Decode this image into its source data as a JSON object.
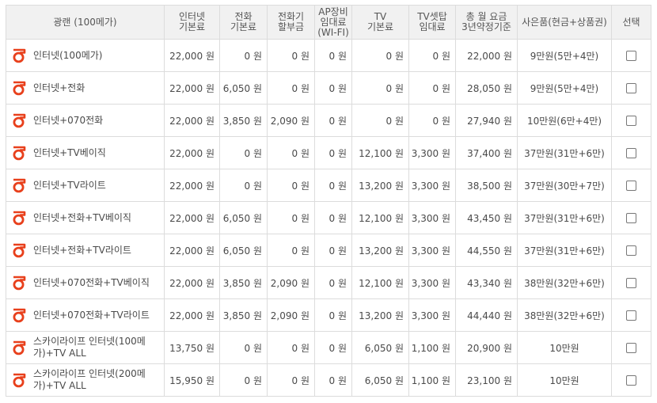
{
  "colors": {
    "brand": "#e8401c",
    "header_bg": "#f1f1f1",
    "border": "#dcdcdc"
  },
  "header": {
    "plan": "광랜 (100메가)",
    "internet": [
      "인터넷",
      "기본료"
    ],
    "phone": [
      "전화",
      "기본료"
    ],
    "phone_device": [
      "전화기",
      "할부금"
    ],
    "ap": [
      "AP장비",
      "임대료",
      "(WI-FI)"
    ],
    "tv": [
      "TV",
      "기본료"
    ],
    "settop": [
      "TV셋탑",
      "임대료"
    ],
    "total": [
      "총 월 요금",
      "3년약정기준"
    ],
    "gift": "사은품(현금+상품권)",
    "select": "선택"
  },
  "rows": [
    {
      "logo": "olleh-logo-icon",
      "name": "인터넷(100메가)",
      "internet": "22,000 원",
      "phone": "0 원",
      "phone_device": "0 원",
      "ap": "0 원",
      "tv": "0 원",
      "settop": "0 원",
      "total": "22,000 원",
      "gift": "9만원(5만+4만)",
      "checked": false
    },
    {
      "logo": "olleh-logo-icon",
      "name": "인터넷+전화",
      "internet": "22,000 원",
      "phone": "6,050 원",
      "phone_device": "0 원",
      "ap": "0 원",
      "tv": "0 원",
      "settop": "0 원",
      "total": "28,050 원",
      "gift": "9만원(5만+4만)",
      "checked": false
    },
    {
      "logo": "olleh-logo-icon",
      "name": "인터넷+070전화",
      "internet": "22,000 원",
      "phone": "3,850 원",
      "phone_device": "2,090 원",
      "ap": "0 원",
      "tv": "0 원",
      "settop": "0 원",
      "total": "27,940 원",
      "gift": "10만원(6만+4만)",
      "checked": false
    },
    {
      "logo": "olleh-logo-icon",
      "name": "인터넷+TV베이직",
      "internet": "22,000 원",
      "phone": "0 원",
      "phone_device": "0 원",
      "ap": "0 원",
      "tv": "12,100 원",
      "settop": "3,300 원",
      "total": "37,400 원",
      "gift": "37만원(31만+6만)",
      "checked": false
    },
    {
      "logo": "olleh-logo-icon",
      "name": "인터넷+TV라이트",
      "internet": "22,000 원",
      "phone": "0 원",
      "phone_device": "0 원",
      "ap": "0 원",
      "tv": "13,200 원",
      "settop": "3,300 원",
      "total": "38,500 원",
      "gift": "37만원(30만+7만)",
      "checked": false
    },
    {
      "logo": "olleh-logo-icon",
      "name": "인터넷+전화+TV베이직",
      "internet": "22,000 원",
      "phone": "6,050 원",
      "phone_device": "0 원",
      "ap": "0 원",
      "tv": "12,100 원",
      "settop": "3,300 원",
      "total": "43,450 원",
      "gift": "37만원(31만+6만)",
      "checked": false
    },
    {
      "logo": "olleh-logo-icon",
      "name": "인터넷+전화+TV라이트",
      "internet": "22,000 원",
      "phone": "6,050 원",
      "phone_device": "0 원",
      "ap": "0 원",
      "tv": "13,200 원",
      "settop": "3,300 원",
      "total": "44,550 원",
      "gift": "37만원(31만+6만)",
      "checked": false
    },
    {
      "logo": "olleh-logo-icon",
      "name": "인터넷+070전화+TV베이직",
      "internet": "22,000 원",
      "phone": "3,850 원",
      "phone_device": "2,090 원",
      "ap": "0 원",
      "tv": "12,100 원",
      "settop": "3,300 원",
      "total": "43,340 원",
      "gift": "38만원(32만+6만)",
      "checked": false
    },
    {
      "logo": "olleh-logo-icon",
      "name": "인터넷+070전화+TV라이트",
      "internet": "22,000 원",
      "phone": "3,850 원",
      "phone_device": "2,090 원",
      "ap": "0 원",
      "tv": "13,200 원",
      "settop": "3,300 원",
      "total": "44,440 원",
      "gift": "38만원(32만+6만)",
      "checked": false
    },
    {
      "logo": "olleh-logo-icon",
      "name": "스카이라이프 인터넷(100메가)+TV ALL",
      "internet": "13,750 원",
      "phone": "0 원",
      "phone_device": "0 원",
      "ap": "0 원",
      "tv": "6,050 원",
      "settop": "1,100 원",
      "total": "20,900 원",
      "gift": "10만원",
      "checked": false
    },
    {
      "logo": "olleh-logo-icon",
      "name": "스카이라이프 인터넷(200메가)+TV ALL",
      "internet": "15,950 원",
      "phone": "0 원",
      "phone_device": "0 원",
      "ap": "0 원",
      "tv": "6,050 원",
      "settop": "1,100 원",
      "total": "23,100 원",
      "gift": "10만원",
      "checked": false
    }
  ]
}
